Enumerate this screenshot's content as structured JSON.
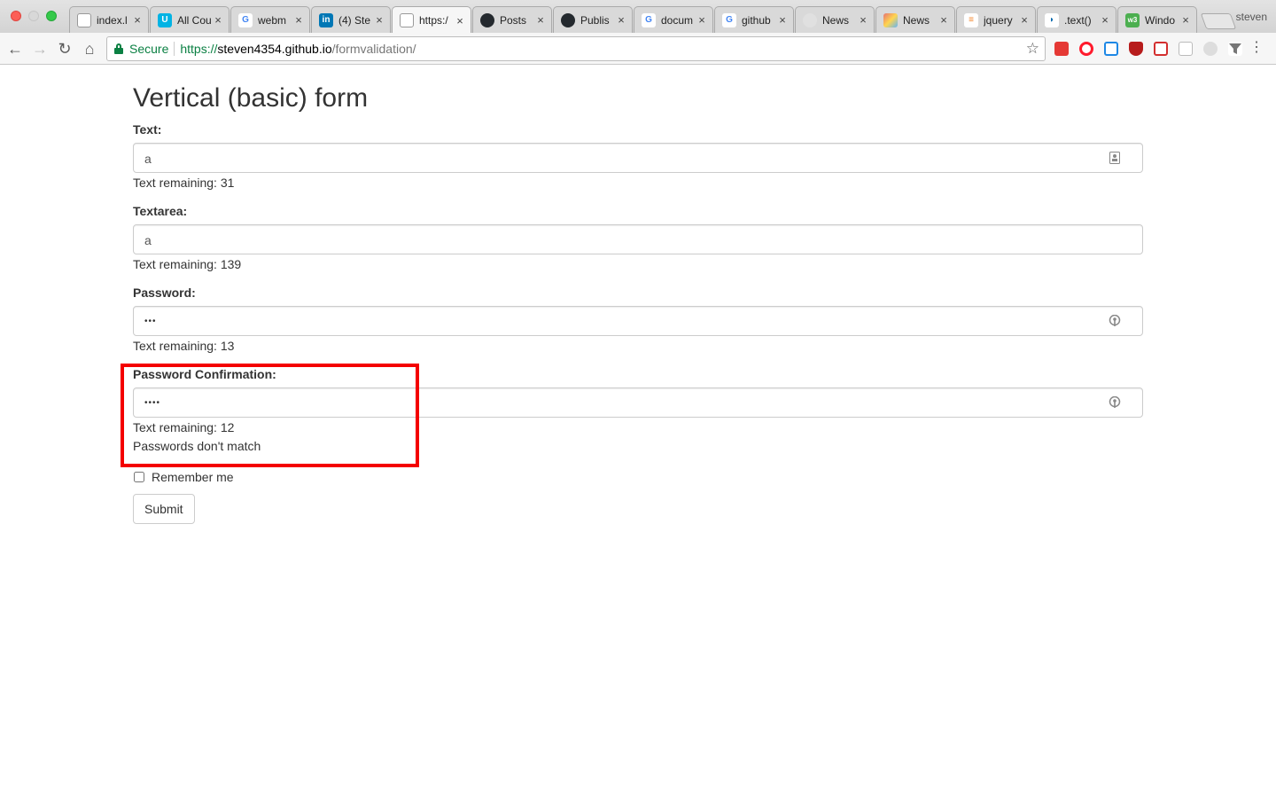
{
  "browser": {
    "profile": "steven",
    "tabs": [
      {
        "title": "index.l",
        "icon": "page-icon",
        "color": "#999999"
      },
      {
        "title": "All Cou",
        "icon": "udacity-icon",
        "color": "#02b3e4"
      },
      {
        "title": "webm",
        "icon": "google-icon",
        "color": "#4285f4"
      },
      {
        "title": "(4) Ste",
        "icon": "linkedin-icon",
        "color": "#0077b5"
      },
      {
        "title": "https:/",
        "icon": "page-icon",
        "color": "#999999",
        "active": true
      },
      {
        "title": "Posts",
        "icon": "github-icon",
        "color": "#24292e"
      },
      {
        "title": "Publis",
        "icon": "github-icon",
        "color": "#24292e"
      },
      {
        "title": "docum",
        "icon": "google-icon",
        "color": "#4285f4"
      },
      {
        "title": "github",
        "icon": "google-icon",
        "color": "#4285f4"
      },
      {
        "title": "News",
        "icon": "person-icon",
        "color": "#777777"
      },
      {
        "title": "News",
        "icon": "news-icon",
        "color": "#e57373"
      },
      {
        "title": "jquery",
        "icon": "stackoverflow-icon",
        "color": "#f48024"
      },
      {
        "title": ".text()",
        "icon": "jquery-icon",
        "color": "#0769ad"
      },
      {
        "title": "Windo",
        "icon": "w3schools-icon",
        "color": "#4caf50"
      }
    ],
    "secure_label": "Secure",
    "url": {
      "scheme": "https://",
      "host": "steven4354.github.io",
      "path": "/formvalidation/"
    }
  },
  "page": {
    "title": "Vertical (basic) form",
    "fields": [
      {
        "label": "Text:",
        "value": "a",
        "help": "Text remaining: 31",
        "icon": "contact-card-icon"
      },
      {
        "label": "Textarea:",
        "value": "a",
        "help": "Text remaining: 139"
      },
      {
        "label": "Password:",
        "value": "•••",
        "help": "Text remaining: 13",
        "icon": "key-icon"
      },
      {
        "label": "Password Confirmation:",
        "value": "••••",
        "help": "Text remaining: 12",
        "error": "Passwords don't match",
        "icon": "key-icon"
      }
    ],
    "remember_label": "Remember me",
    "submit_label": "Submit"
  }
}
